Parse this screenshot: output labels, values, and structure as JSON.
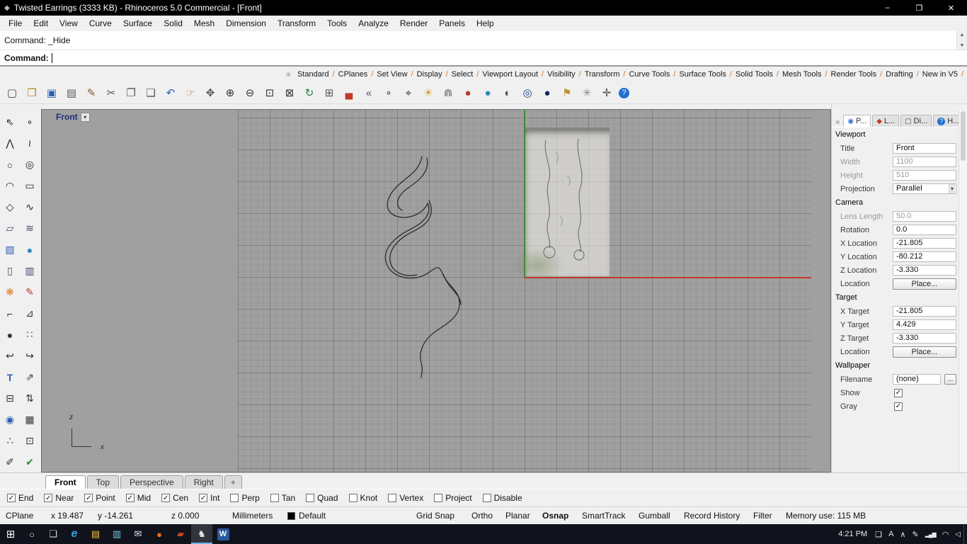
{
  "window": {
    "app_icon": "◆",
    "title": "Twisted Earrings (3333 KB) - Rhinoceros 5.0 Commercial - [Front]",
    "minimize": "–",
    "maximize": "❐",
    "close": "✕"
  },
  "icons": {
    "check": "✓",
    "dropdown_arrow": "▾"
  },
  "menu": {
    "items": [
      {
        "label": "File"
      },
      {
        "label": "Edit"
      },
      {
        "label": "View"
      },
      {
        "label": "Curve"
      },
      {
        "label": "Surface"
      },
      {
        "label": "Solid"
      },
      {
        "label": "Mesh"
      },
      {
        "label": "Dimension"
      },
      {
        "label": "Transform"
      },
      {
        "label": "Tools"
      },
      {
        "label": "Analyze"
      },
      {
        "label": "Render"
      },
      {
        "label": "Panels"
      },
      {
        "label": "Help"
      }
    ]
  },
  "command": {
    "history_line": "Command: _Hide",
    "prompt": "Command:",
    "input_value": "",
    "scroll_up": "▲",
    "scroll_down": "▼"
  },
  "toolbar_tabs": {
    "settings_icon": "✳",
    "items": [
      {
        "label": "Standard"
      },
      {
        "label": "CPlanes"
      },
      {
        "label": "Set View"
      },
      {
        "label": "Display"
      },
      {
        "label": "Select"
      },
      {
        "label": "Viewport Layout"
      },
      {
        "label": "Visibility"
      },
      {
        "label": "Transform"
      },
      {
        "label": "Curve Tools"
      },
      {
        "label": "Surface Tools"
      },
      {
        "label": "Solid Tools"
      },
      {
        "label": "Mesh Tools"
      },
      {
        "label": "Render Tools"
      },
      {
        "label": "Drafting"
      },
      {
        "label": "New in V5"
      }
    ]
  },
  "toolbar": {
    "items": [
      {
        "name": "new-document-icon",
        "glyph": "▢",
        "style": "color:#444"
      },
      {
        "name": "open-file-icon",
        "glyph": "❒",
        "style": "color:#b8860b"
      },
      {
        "name": "save-icon",
        "glyph": "▣",
        "style": "color:#2b5fb0"
      },
      {
        "name": "print-icon",
        "glyph": "▤",
        "style": "color:#555"
      },
      {
        "name": "annotate-icon",
        "glyph": "✎",
        "style": "color:#8a5a2a"
      },
      {
        "name": "cut-icon",
        "glyph": "✂",
        "style": "color:#555"
      },
      {
        "name": "copy-icon",
        "glyph": "❐",
        "style": "color:#555"
      },
      {
        "name": "paste-icon",
        "glyph": "❏",
        "style": "color:#555"
      },
      {
        "name": "undo-icon",
        "glyph": "↶",
        "style": "color:#2b5fb0"
      },
      {
        "name": "pan-hand-icon",
        "glyph": "☞",
        "style": "color:#b07a3a"
      },
      {
        "name": "move-icon",
        "glyph": "✥",
        "style": "color:#555"
      },
      {
        "name": "zoom-icon",
        "glyph": "⊕",
        "style": "color:#333"
      },
      {
        "name": "zoom-dynamic-icon",
        "glyph": "⊖",
        "style": "color:#333"
      },
      {
        "name": "zoom-window-icon",
        "glyph": "⊡",
        "style": "color:#333"
      },
      {
        "name": "zoom-extents-icon",
        "glyph": "⊠",
        "style": "color:#333"
      },
      {
        "name": "rotate-view-icon",
        "glyph": "↻",
        "style": "color:#2a7d46"
      },
      {
        "name": "viewport-layout-icon",
        "glyph": "⊞",
        "style": "color:#555"
      },
      {
        "name": "car-icon",
        "glyph": "▄",
        "style": "color:#c0392b"
      },
      {
        "name": "previous-view-icon",
        "glyph": "«",
        "style": "color:#555"
      },
      {
        "name": "point-icon",
        "glyph": "∘",
        "style": "color:#333"
      },
      {
        "name": "object-snap-icon",
        "glyph": "⌖",
        "style": "color:#333"
      },
      {
        "name": "light-icon",
        "glyph": "☀",
        "style": "color:#c9a227"
      },
      {
        "name": "lock-icon",
        "glyph": "⋒",
        "style": "color:#666"
      },
      {
        "name": "render-red-sphere-icon",
        "glyph": "●",
        "style": "color:#b23b2e"
      },
      {
        "name": "render-earth-icon",
        "glyph": "●",
        "style": "color:#2e86c1"
      },
      {
        "name": "render-shaded-icon",
        "glyph": "◐",
        "style": "color:#4a4a4a"
      },
      {
        "name": "render-ghosted-icon",
        "glyph": "◎",
        "style": "color:#1a3a8a"
      },
      {
        "name": "render-rendered-icon",
        "glyph": "●",
        "style": "color:#13275e"
      },
      {
        "name": "flag-icon",
        "glyph": "⚑",
        "style": "color:#b8962e"
      },
      {
        "name": "gears-icon",
        "glyph": "✳",
        "style": "color:#888"
      },
      {
        "name": "cplane-axis-icon",
        "glyph": "✛",
        "style": "color:#444"
      },
      {
        "name": "help-icon",
        "glyph": "?",
        "style": "background:#1f6fd0;color:#fff;border-radius:50%;width:15px;height:15px;line-height:15px;font-size:11px;text-align:center;display:inline-block"
      }
    ]
  },
  "left_toolbar": {
    "items": [
      {
        "name": "select-arrow-icon",
        "glyph": "⇖",
        "style": "color:#222"
      },
      {
        "name": "single-point-icon",
        "glyph": "∘",
        "style": "color:#222"
      },
      {
        "name": "polyline-icon",
        "glyph": "⋀",
        "style": "color:#222"
      },
      {
        "name": "curve-interpolate-icon",
        "glyph": "≀",
        "style": "color:#222"
      },
      {
        "name": "circle-icon",
        "glyph": "○",
        "style": "color:#222"
      },
      {
        "name": "ellipse-icon",
        "glyph": "◎",
        "style": "color:#222"
      },
      {
        "name": "arc-icon",
        "glyph": "◠",
        "style": "color:#222"
      },
      {
        "name": "rectangle-icon",
        "glyph": "▭",
        "style": "color:#222"
      },
      {
        "name": "polygon-icon",
        "glyph": "◇",
        "style": "color:#222"
      },
      {
        "name": "freeform-curve-icon",
        "glyph": "∿",
        "style": "color:#222"
      },
      {
        "name": "surface-icon",
        "glyph": "▱",
        "style": "color:#446"
      },
      {
        "name": "loft-icon",
        "glyph": "≋",
        "style": "color:#446"
      },
      {
        "name": "box-icon",
        "glyph": "▧",
        "style": "color:#2b5fb0"
      },
      {
        "name": "sphere-icon",
        "glyph": "●",
        "style": "color:#2e86c1"
      },
      {
        "name": "cylinder-icon",
        "glyph": "▯",
        "style": "color:#446"
      },
      {
        "name": "extrude-icon",
        "glyph": "▥",
        "style": "color:#446"
      },
      {
        "name": "render-flower-icon",
        "glyph": "❋",
        "style": "color:#e67e22"
      },
      {
        "name": "sketch-pencil-icon",
        "glyph": "✎",
        "style": "color:#c0392b"
      },
      {
        "name": "fillet-icon",
        "glyph": "⌐",
        "style": "color:#333"
      },
      {
        "name": "chamfer-icon",
        "glyph": "⊿",
        "style": "color:#333"
      },
      {
        "name": "boolean-sphere-icon",
        "glyph": "●",
        "style": "color:#333"
      },
      {
        "name": "points-grid-icon",
        "glyph": "∷",
        "style": "color:#a33"
      },
      {
        "name": "curve-hook-icon",
        "glyph": "↩",
        "style": "color:#333"
      },
      {
        "name": "curve-hook-alt-icon",
        "glyph": "↪",
        "style": "color:#333"
      },
      {
        "name": "text-icon",
        "glyph": "T",
        "style": "color:#2b5fb0;font-weight:bold"
      },
      {
        "name": "leader-icon",
        "glyph": "⇗",
        "style": "color:#333"
      },
      {
        "name": "array-icon",
        "glyph": "⊟",
        "style": "color:#333"
      },
      {
        "name": "align-icon",
        "glyph": "⇅",
        "style": "color:#333"
      },
      {
        "name": "gumball-icon",
        "glyph": "◉",
        "style": "color:#2b5fb0"
      },
      {
        "name": "hatch-icon",
        "glyph": "▦",
        "style": "color:#333"
      },
      {
        "name": "dots-icon",
        "glyph": "∴",
        "style": "color:#333"
      },
      {
        "name": "block-icon",
        "glyph": "⊡",
        "style": "color:#333"
      },
      {
        "name": "drafting-icon",
        "glyph": "✐",
        "style": "color:#333"
      },
      {
        "name": "check-icon",
        "glyph": "✔",
        "style": "color:#2a8f2a"
      }
    ]
  },
  "viewport": {
    "title": "Front",
    "title_dropdown": "▾",
    "axis_x_label": "x",
    "axis_z_label": "z",
    "curves": [
      "M537,66 C533,88 516,94 502,108 C486,124 483,141 498,149 C514,157 539,148 545,132 C551,145 542,158 522,168 C498,180 482,196 486,214 C491,235 518,243 539,234 C553,228 559,215 565,229 C573,249 589,254 590,271 C592,292 572,302 556,313 C539,325 532,342 536,357 C539,369 536,373 536,378",
      "M544,68 C549,90 530,101 514,113 C501,123 499,137 509,142 M547,128 C557,150 543,163 524,172 C502,183 490,198 492,213 C494,229 511,237 530,233 M567,232 C575,254 592,260 592,275"
    ],
    "sketch_strokes": [
      "M30,14 C26,36 40,52 34,72 C28,92 40,108 33,128 C29,144 38,156 35,166",
      "M76,12 C72,36 86,58 79,80 C73,100 84,118 77,138 C73,152 82,163 78,172",
      "M27,172 a8,8 0 1 0 16,0 a8,8 0 1 0 -16,0 M70,176 a7,7 0 1 0 14,0 a7,7 0 1 0 -14,0",
      "M44,30 q6,8 1,16 M60,64 q7,6 2,14 M50,120 q6,8 1,15"
    ]
  },
  "viewport_tabs": {
    "items": [
      {
        "label": "Front",
        "active": true,
        "name": "viewport-tab-front"
      },
      {
        "label": "Top",
        "name": "viewport-tab-top"
      },
      {
        "label": "Perspective",
        "name": "viewport-tab-perspective"
      },
      {
        "label": "Right",
        "name": "viewport-tab-right"
      },
      {
        "label": "+",
        "add": true,
        "name": "viewport-tab-add"
      }
    ]
  },
  "osnap": {
    "items": [
      {
        "label": "End",
        "checked": true,
        "name": "osnap-end-checkbox"
      },
      {
        "label": "Near",
        "checked": true,
        "name": "osnap-near-checkbox"
      },
      {
        "label": "Point",
        "checked": true,
        "name": "osnap-point-checkbox"
      },
      {
        "label": "Mid",
        "checked": true,
        "name": "osnap-mid-checkbox"
      },
      {
        "label": "Cen",
        "checked": true,
        "name": "osnap-cen-checkbox"
      },
      {
        "label": "Int",
        "checked": true,
        "name": "osnap-int-checkbox"
      },
      {
        "label": "Perp",
        "name": "osnap-perp-checkbox"
      },
      {
        "label": "Tan",
        "name": "osnap-tan-checkbox"
      },
      {
        "label": "Quad",
        "name": "osnap-quad-checkbox"
      },
      {
        "label": "Knot",
        "name": "osnap-knot-checkbox"
      },
      {
        "label": "Vertex",
        "name": "osnap-vertex-checkbox"
      },
      {
        "label": "Project",
        "name": "osnap-project-checkbox"
      },
      {
        "label": "Disable",
        "name": "osnap-disable-checkbox"
      }
    ]
  },
  "statusbar": {
    "items": [
      {
        "label": "CPlane",
        "name": "cplane-pane"
      },
      {
        "label": "x 19.487",
        "name": "x-coordinate"
      },
      {
        "label": "y -14.261",
        "name": "y-coordinate"
      },
      {
        "label": "z 0.000",
        "name": "z-coordinate"
      },
      {
        "label": "Millimeters",
        "name": "units-pane"
      },
      {
        "label": "Default",
        "name": "layer-pane",
        "swatch_style": "background:#000000"
      },
      {
        "label": "Grid Snap",
        "name": "grid-snap-toggle"
      },
      {
        "label": "Ortho",
        "name": "ortho-toggle"
      },
      {
        "label": "Planar",
        "name": "planar-toggle"
      },
      {
        "label": "Osnap",
        "active": true,
        "name": "osnap-toggle"
      },
      {
        "label": "SmartTrack",
        "name": "smarttrack-toggle"
      },
      {
        "label": "Gumball",
        "name": "gumball-toggle"
      },
      {
        "label": "Record History",
        "name": "record-history-toggle"
      },
      {
        "label": "Filter",
        "name": "filter-toggle"
      },
      {
        "label": "Memory use: 115 MB",
        "name": "memory-use",
        "interactable": "false"
      }
    ]
  },
  "panel": {
    "settings_icon": "✳",
    "tabs": [
      {
        "label": "P...",
        "name": "tab-properties",
        "active": true,
        "icon": "◉",
        "icon_name": "properties-icon",
        "icon_style": "color:#3a6fd0"
      },
      {
        "label": "L...",
        "name": "tab-layers",
        "icon": "◆",
        "icon_name": "layers-icon",
        "icon_style": "color:#c0392b"
      },
      {
        "label": "Di...",
        "name": "tab-display",
        "icon": "▢",
        "icon_name": "display-icon",
        "icon_style": "color:#34495e"
      },
      {
        "label": "H...",
        "name": "tab-help",
        "icon": "?",
        "icon_name": "panel-help-icon",
        "icon_style": "background:#1f6fd0;color:#fff;border-radius:50%;width:11px;height:11px;line-height:11px;font-size:9px;text-align:center;display:inline-block"
      }
    ],
    "rows": [
      {
        "type": "section",
        "label": "Viewport"
      },
      {
        "type": "field",
        "label": "Title",
        "value": "Front",
        "name": "viewport-title-field"
      },
      {
        "type": "field",
        "label": "Width",
        "value": "1100",
        "disabled": true,
        "name": "viewport-width-field"
      },
      {
        "type": "field",
        "label": "Height",
        "value": "510",
        "disabled": true,
        "name": "viewport-height-field"
      },
      {
        "type": "dropdown",
        "label": "Projection",
        "value": "Parallel",
        "name": "projection-dropdown"
      },
      {
        "type": "section",
        "label": "Camera"
      },
      {
        "type": "field",
        "label": "Lens Length",
        "value": "50.0",
        "disabled": true,
        "name": "lens-length-field"
      },
      {
        "type": "field",
        "label": "Rotation",
        "value": "0.0",
        "name": "rotation-field"
      },
      {
        "type": "field",
        "label": "X Location",
        "value": "-21.805",
        "name": "x-location-field"
      },
      {
        "type": "field",
        "label": "Y Location",
        "value": "-80.212",
        "name": "y-location-field"
      },
      {
        "type": "field",
        "label": "Z Location",
        "value": "-3.330",
        "name": "z-location-field"
      },
      {
        "type": "button",
        "label": "Location",
        "value": "Place...",
        "name": "camera-place-button"
      },
      {
        "type": "section",
        "label": "Target"
      },
      {
        "type": "field",
        "label": "X Target",
        "value": "-21.805",
        "name": "x-target-field"
      },
      {
        "type": "field",
        "label": "Y Target",
        "value": "4.429",
        "name": "y-target-field"
      },
      {
        "type": "field",
        "label": "Z Target",
        "value": "-3.330",
        "name": "z-target-field"
      },
      {
        "type": "button",
        "label": "Location",
        "value": "Place...",
        "name": "target-place-button"
      },
      {
        "type": "section",
        "label": "Wallpaper"
      },
      {
        "type": "file",
        "label": "Filename",
        "value": "(none)",
        "button": "...",
        "name": "wallpaper-filename-field"
      },
      {
        "type": "checkbox",
        "label": "Show",
        "checked": true,
        "name": "wallpaper-show-checkbox"
      },
      {
        "type": "checkbox",
        "label": "Gray",
        "checked": true,
        "name": "wallpaper-gray-checkbox"
      }
    ]
  },
  "taskbar": {
    "clock": "4:21 PM",
    "action_center_icon": "❏",
    "items": [
      {
        "name": "start-button",
        "glyph": "⊞",
        "style": "color:#fff;font-size:15px"
      },
      {
        "name": "search-button",
        "glyph": "○",
        "style": "color:#ddd"
      },
      {
        "name": "task-view-button",
        "glyph": "❏",
        "style": "color:#ddd"
      },
      {
        "name": "edge-app-icon",
        "glyph": "e",
        "style": "color:#35a3e8;font-weight:bold;font-style:italic;font-size:16px"
      },
      {
        "name": "file-explorer-app-icon",
        "glyph": "▤",
        "style": "color:#f2c14b"
      },
      {
        "name": "store-app-icon",
        "glyph": "▥",
        "style": "color:#79c8e8"
      },
      {
        "name": "mail-app-icon",
        "glyph": "✉",
        "style": "color:#d8e6f2"
      },
      {
        "name": "firefox-app-icon",
        "glyph": "●",
        "style": "color:#f06f1d"
      },
      {
        "name": "powerpoint-app-icon",
        "glyph": "▰",
        "style": "color:#d04423"
      },
      {
        "name": "rhinoceros-app-icon",
        "glyph": "♞",
        "style": "color:#e8e8e8",
        "active": true
      },
      {
        "name": "word-app-icon",
        "glyph": "W",
        "style": "background:#2b579a;color:#fff;font-weight:bold;font-size:11px;width:17px;height:17px;line-height:17px;text-align:center;border-radius:2px"
      }
    ],
    "tray": [
      {
        "name": "ime-indicator",
        "glyph": "A",
        "style": "color:#e8e8e8"
      },
      {
        "name": "tray-expand-icon",
        "glyph": "∧",
        "style": "color:#e8e8e8"
      },
      {
        "name": "pen-icon",
        "glyph": "✎",
        "style": "color:#e8e8e8"
      },
      {
        "name": "network-icon",
        "glyph": "▂▄▆",
        "style": "font-size:8px;letter-spacing:-1px"
      },
      {
        "name": "wifi-icon",
        "glyph": "◠",
        "style": "color:#e8e8e8"
      },
      {
        "name": "volume-icon",
        "glyph": "◁",
        "style": "color:#e8e8e8;font-size:10px"
      }
    ]
  }
}
